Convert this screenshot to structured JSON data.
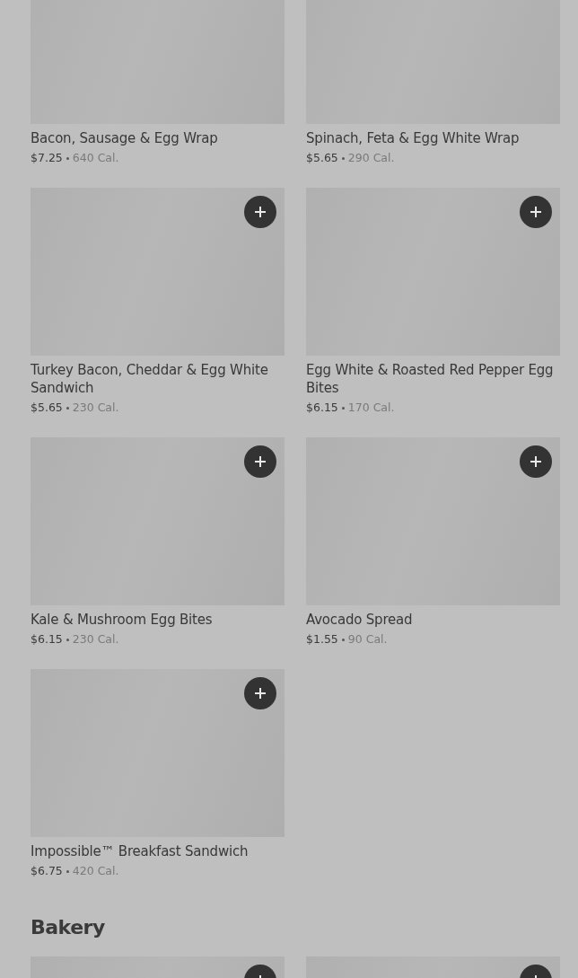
{
  "sections": [
    {
      "items": [
        {
          "name": "Bacon, Sausage & Egg Wrap",
          "price": "$7.25",
          "calories": "640 Cal.",
          "add_button": false
        },
        {
          "name": "Spinach, Feta & Egg White Wrap",
          "price": "$5.65",
          "calories": "290 Cal.",
          "add_button": false
        },
        {
          "name": "Turkey Bacon, Cheddar & Egg White Sandwich",
          "price": "$5.65",
          "calories": "230 Cal.",
          "add_button": true
        },
        {
          "name": "Egg White & Roasted Red Pepper Egg Bites",
          "price": "$6.15",
          "calories": "170 Cal.",
          "add_button": true
        },
        {
          "name": "Kale & Mushroom Egg Bites",
          "price": "$6.15",
          "calories": "230 Cal.",
          "add_button": true
        },
        {
          "name": "Avocado Spread",
          "price": "$1.55",
          "calories": "90 Cal.",
          "add_button": true
        },
        {
          "name": "Impossible™ Breakfast Sandwich",
          "price": "$6.75",
          "calories": "420 Cal.",
          "add_button": true
        }
      ]
    },
    {
      "title": "Bakery",
      "items": [
        {
          "add_button": true
        },
        {
          "add_button": true
        }
      ]
    }
  ]
}
